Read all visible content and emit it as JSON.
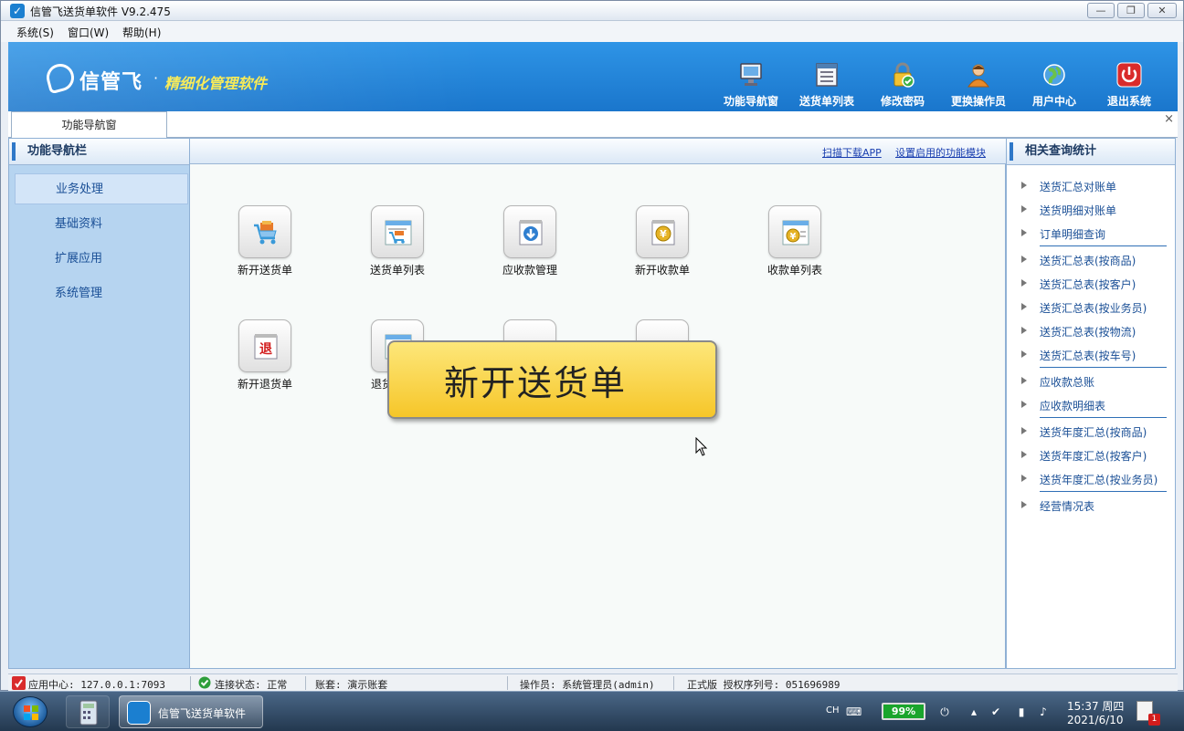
{
  "window": {
    "title": "信管飞送货单软件 V9.2.475",
    "minimize": "—",
    "maximize": "❐",
    "close": "✕"
  },
  "menubar": [
    "系统(S)",
    "窗口(W)",
    "帮助(H)"
  ],
  "banner": {
    "logo_text": "信管飞",
    "dot": "·",
    "slogan": "精细化管理软件"
  },
  "toolbar": [
    {
      "label": "功能导航窗",
      "icon": "monitor-icon"
    },
    {
      "label": "送货单列表",
      "icon": "list-icon"
    },
    {
      "label": "修改密码",
      "icon": "lock-icon"
    },
    {
      "label": "更换操作员",
      "icon": "user-icon"
    },
    {
      "label": "用户中心",
      "icon": "globe-icon"
    },
    {
      "label": "退出系统",
      "icon": "power-icon"
    }
  ],
  "tabs": {
    "active": "功能导航窗",
    "close": "×"
  },
  "left_panel": {
    "title": "功能导航栏",
    "items": [
      "业务处理",
      "基础资料",
      "扩展应用",
      "系统管理"
    ],
    "active_index": 0
  },
  "links": {
    "scan_app": "扫描下载APP",
    "module_setup": "设置启用的功能模块"
  },
  "tiles": [
    {
      "label": "新开送货单",
      "icon": "cart-icon"
    },
    {
      "label": "送货单列表",
      "icon": "cart-list-icon"
    },
    {
      "label": "应收款管理",
      "icon": "receivable-icon"
    },
    {
      "label": "新开收款单",
      "icon": "yen-note-icon"
    },
    {
      "label": "收款单列表",
      "icon": "yen-list-icon"
    },
    {
      "label": "新开退货单",
      "icon": "return-icon"
    },
    {
      "label": "退货",
      "icon": "return-list-icon"
    }
  ],
  "tooltip": "新开送货单",
  "right_panel": {
    "title": "相关查询统计",
    "groups": [
      [
        "送货汇总对账单",
        "送货明细对账单",
        "订单明细查询"
      ],
      [
        "送货汇总表(按商品)",
        "送货汇总表(按客户)",
        "送货汇总表(按业务员)",
        "送货汇总表(按物流)",
        "送货汇总表(按车号)"
      ],
      [
        "应收款总账",
        "应收款明细表"
      ],
      [
        "送货年度汇总(按商品)",
        "送货年度汇总(按客户)",
        "送货年度汇总(按业务员)"
      ],
      [
        "经营情况表"
      ]
    ]
  },
  "statusbar": {
    "app_center": "应用中心: 127.0.0.1:7093",
    "connection": "连接状态: 正常",
    "account": "账套: 演示账套",
    "operator": "操作员: 系统管理员(admin)",
    "license": "正式版 授权序列号: 051696989"
  },
  "taskbar": {
    "app_label": "信管飞送货单软件",
    "lang": "CH",
    "battery": "99%",
    "time": "15:37 周四",
    "date": "2021/6/10",
    "notifications": "1"
  },
  "colors": {
    "banner": "#1f82d6",
    "slogan": "#f7e94a",
    "tooltip": "#f6c629",
    "link": "#1a3fb0"
  }
}
